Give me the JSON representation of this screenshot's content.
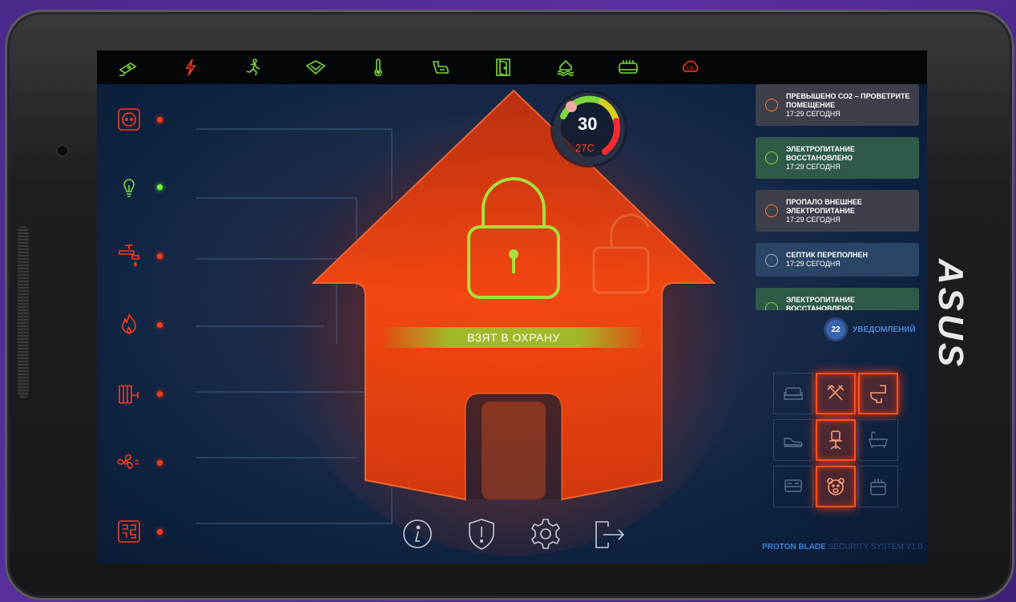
{
  "device": {
    "brand": "ASUS"
  },
  "topbar": {
    "icons": [
      "camera-icon",
      "lightning-icon",
      "motion-icon",
      "leak-sensor-icon",
      "thermometer-icon",
      "water-valve-icon",
      "door-icon",
      "flood-icon",
      "radiator-icon",
      "co2-icon"
    ],
    "co2_label": "CO₂"
  },
  "sidebar": {
    "items": [
      {
        "name": "socket-icon",
        "status": "red"
      },
      {
        "name": "lightbulb-icon",
        "status": "green"
      },
      {
        "name": "faucet-icon",
        "status": "red"
      },
      {
        "name": "fire-icon",
        "status": "red"
      },
      {
        "name": "radiator-icon",
        "status": "red"
      },
      {
        "name": "fan-icon",
        "status": "red"
      },
      {
        "name": "circuit-icon",
        "status": "red"
      }
    ]
  },
  "gauge": {
    "value": "30",
    "temp": "27C"
  },
  "status": {
    "label": "ВЗЯТ В ОХРАНУ"
  },
  "notifications": {
    "items": [
      {
        "text": "ПРЕВЫШЕНО СО2 – ПРОВЕТРИТЕ ПОМЕЩЕНИЕ",
        "time": "17:29 СЕГОДНЯ",
        "kind": "warning",
        "color": "#3d3f4a"
      },
      {
        "text": "ЭЛЕКТРОПИТАНИЕ ВОССТАНОВЛЕНО",
        "time": "17:29 СЕГОДНЯ",
        "kind": "ok",
        "color": "#2f5a48"
      },
      {
        "text": "ПРОПАЛО ВНЕШНЕЕ ЭЛЕКТРОПИТАНИЕ",
        "time": "17:29 СЕГОДНЯ",
        "kind": "warning",
        "color": "#3d3f4a"
      },
      {
        "text": "СЕПТИК ПЕРЕПОЛНЕН",
        "time": "17:29 СЕГОДНЯ",
        "kind": "ok",
        "color": "#2a4566"
      },
      {
        "text": "ЭЛЕКТРОПИТАНИЕ ВОССТАНОВЛЕНО",
        "time": "",
        "kind": "ok",
        "color": "#2f5a48"
      }
    ],
    "count": "22",
    "count_label": "УВЕДОМЛЕНИЙ"
  },
  "rooms": [
    {
      "name": "sofa-icon",
      "active": false
    },
    {
      "name": "kitchen-utensils-icon",
      "active": true
    },
    {
      "name": "toilet-icon",
      "active": true
    },
    {
      "name": "shoes-icon",
      "active": false
    },
    {
      "name": "office-chair-icon",
      "active": true
    },
    {
      "name": "bathtub-icon",
      "active": false
    },
    {
      "name": "bed-icon",
      "active": false
    },
    {
      "name": "teddy-bear-icon",
      "active": true
    },
    {
      "name": "washing-icon",
      "active": false
    }
  ],
  "footer": {
    "product": "PROTON BLADE",
    "suffix": "SECURITY SYSTEM V1.0"
  },
  "bottom": {
    "icons": [
      "info-icon",
      "shield-alert-icon",
      "settings-icon",
      "logout-icon"
    ]
  },
  "colors": {
    "accent": "#ff4a1a",
    "ok": "#9ee23a",
    "footer_accent": "#3f7fd8",
    "footer_dim": "#2c4a78"
  }
}
